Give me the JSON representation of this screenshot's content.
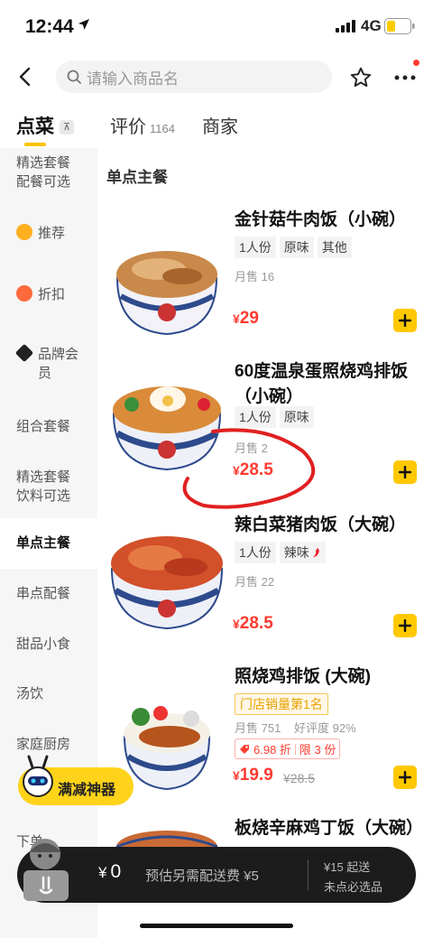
{
  "status_bar": {
    "time": "12:44",
    "network": "4G"
  },
  "search": {
    "placeholder": "请输入商品名"
  },
  "tabs": [
    {
      "label": "点菜"
    },
    {
      "label": "评价",
      "count": "1164"
    },
    {
      "label": "商家"
    }
  ],
  "sidebar": {
    "items": [
      {
        "label": "精选套餐配餐可选"
      },
      {
        "label": "推荐",
        "icon": "thumbs-up-icon"
      },
      {
        "label": "折扣",
        "icon": "discount-icon"
      },
      {
        "label": "品牌会员",
        "icon": "vip-icon"
      },
      {
        "label": "组合套餐"
      },
      {
        "label": "精选套餐饮料可选"
      },
      {
        "label": "单点主餐"
      },
      {
        "label": "串点配餐"
      },
      {
        "label": "甜品小食"
      },
      {
        "label": "汤饮"
      },
      {
        "label": "家庭厨房"
      },
      {
        "label": "下单"
      }
    ]
  },
  "section": {
    "title": "单点主餐"
  },
  "products": [
    {
      "name": "金针菇牛肉饭（小碗）",
      "tags": [
        "1人份",
        "原味",
        "其他"
      ],
      "sales": "月售 16",
      "price_symbol": "¥",
      "price": "29"
    },
    {
      "name": "60度温泉蛋照烧鸡排饭（小碗）",
      "tags": [
        "1人份",
        "原味"
      ],
      "sales": "月售 2",
      "price_symbol": "¥",
      "price": "28.5"
    },
    {
      "name": "辣白菜猪肉饭（大碗）",
      "tags": [
        "1人份",
        "辣味"
      ],
      "sales": "月售 22",
      "price_symbol": "¥",
      "price": "28.5"
    },
    {
      "name": "照烧鸡排饭 (大碗)",
      "rank": "门店销量第1名",
      "sales": "月售 751",
      "rating": "好评度 92%",
      "discount": "6.98 折",
      "limit": "限 3 份",
      "price_symbol": "¥",
      "price": "19.9",
      "original_price": "¥28.5"
    },
    {
      "name": "板烧辛麻鸡丁饭（大碗）"
    }
  ],
  "promo": {
    "label": "满减神器"
  },
  "cart": {
    "currency": "¥",
    "amount": "0",
    "delivery_note": "预估另需配送费 ¥5",
    "min_order": "¥15 起送",
    "required_note": "未点必选品"
  },
  "colors": {
    "accent": "#ffc800",
    "price": "#ff3b30",
    "cart_bg": "#1c1c1c"
  }
}
